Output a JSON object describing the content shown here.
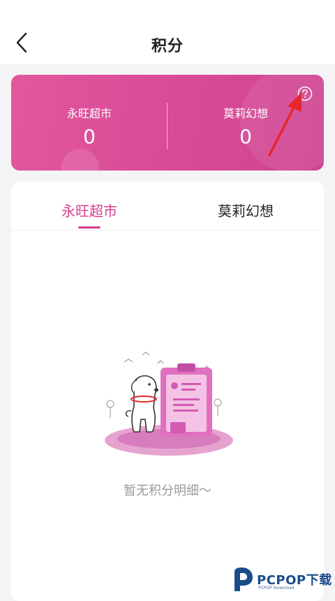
{
  "header": {
    "title": "积分",
    "back_icon": "chevron-left-icon"
  },
  "points_card": {
    "left": {
      "name": "永旺超市",
      "value": "0"
    },
    "right": {
      "name": "莫莉幻想",
      "value": "0"
    },
    "help_icon": "question-circle-icon",
    "gradient_colors": [
      "#e2579c",
      "#cf4492"
    ]
  },
  "tabs": [
    {
      "label": "永旺超市",
      "active": true
    },
    {
      "label": "莫莉幻想",
      "active": false
    }
  ],
  "empty_state": {
    "text": "暂无积分明细～",
    "illustration": "dog-clipboard-illustration"
  },
  "watermark": {
    "brand": "PCPOP下载",
    "sub": "PCPOP Download"
  },
  "colors": {
    "accent": "#d2418f",
    "annotation_arrow": "#e8262a"
  }
}
